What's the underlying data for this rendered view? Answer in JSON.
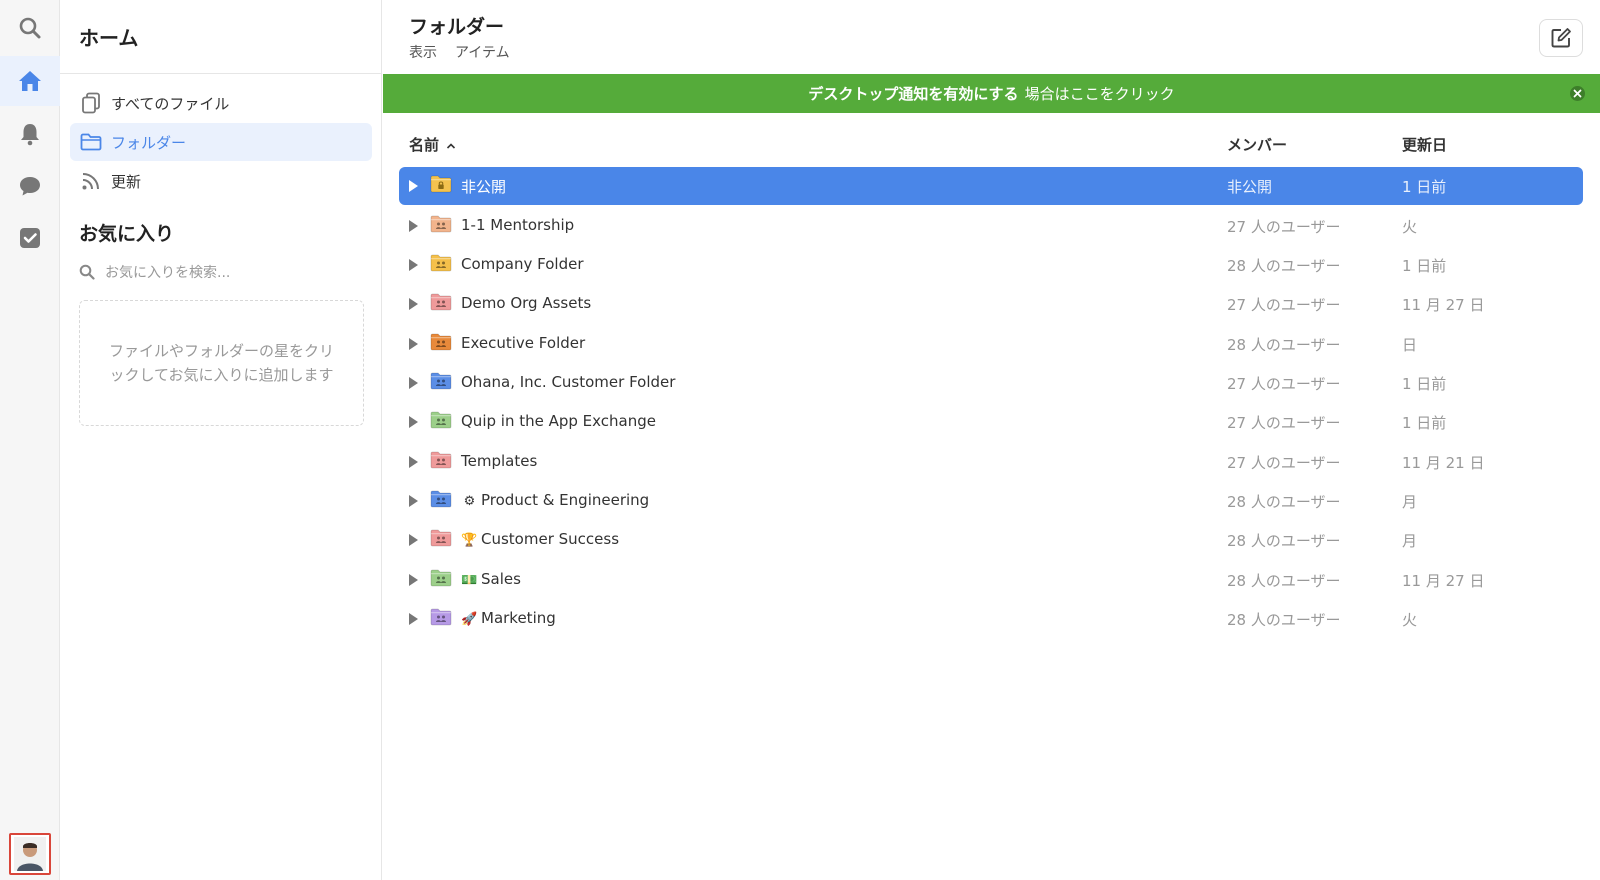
{
  "rail": {
    "icons": [
      "search-icon",
      "home-icon",
      "bell-icon",
      "chat-icon",
      "checkbox-icon"
    ],
    "active": "home-icon"
  },
  "sidebar": {
    "title": "ホーム",
    "items": [
      {
        "label": "すべてのファイル",
        "icon": "files-icon"
      },
      {
        "label": "フォルダー",
        "icon": "folder-outline-icon"
      },
      {
        "label": "更新",
        "icon": "rss-icon"
      }
    ],
    "favorites_title": "お気に入り",
    "favorites_search_placeholder": "お気に入りを検索...",
    "favorites_empty": "ファイルやフォルダーの星をクリックしてお気に入りに追加します"
  },
  "main": {
    "title": "フォルダー",
    "subtabs": [
      "表示",
      "アイテム"
    ],
    "banner": {
      "bold": "デスクトップ通知を有効にする",
      "rest": "場合はここをクリック"
    },
    "columns": {
      "name": "名前",
      "members": "メンバー",
      "updated": "更新日"
    },
    "rows": [
      {
        "name": "非公開",
        "emoji": "",
        "members": "非公開",
        "updated": "1 日前",
        "color": "#f3c24f",
        "kind": "lock",
        "selected": true
      },
      {
        "name": "1-1 Mentorship",
        "emoji": "",
        "members": "27 人のユーザー",
        "updated": "火",
        "color": "#f2b48c",
        "kind": "people",
        "selected": false
      },
      {
        "name": "Company Folder",
        "emoji": "",
        "members": "28 人のユーザー",
        "updated": "1 日前",
        "color": "#f5c04a",
        "kind": "people",
        "selected": false
      },
      {
        "name": "Demo Org Assets",
        "emoji": "",
        "members": "27 人のユーザー",
        "updated": "11 月 27 日",
        "color": "#ef9a9a",
        "kind": "people",
        "selected": false
      },
      {
        "name": "Executive Folder",
        "emoji": "",
        "members": "28 人のユーザー",
        "updated": "日",
        "color": "#e8893a",
        "kind": "people",
        "selected": false
      },
      {
        "name": "Ohana, Inc. Customer Folder",
        "emoji": "",
        "members": "27 人のユーザー",
        "updated": "1 日前",
        "color": "#5b8ee6",
        "kind": "people",
        "selected": false
      },
      {
        "name": "Quip in the App Exchange",
        "emoji": "",
        "members": "27 人のユーザー",
        "updated": "1 日前",
        "color": "#9ccf8a",
        "kind": "people",
        "selected": false
      },
      {
        "name": "Templates",
        "emoji": "",
        "members": "27 人のユーザー",
        "updated": "11 月 21 日",
        "color": "#ef9a9a",
        "kind": "people",
        "selected": false
      },
      {
        "name": "Product & Engineering",
        "emoji": "⚙",
        "members": "28 人のユーザー",
        "updated": "月",
        "color": "#5b8ee6",
        "kind": "people",
        "selected": false
      },
      {
        "name": "Customer Success",
        "emoji": "🏆",
        "members": "28 人のユーザー",
        "updated": "月",
        "color": "#ef9a9a",
        "kind": "people",
        "selected": false
      },
      {
        "name": "Sales",
        "emoji": "💵",
        "members": "28 人のユーザー",
        "updated": "11 月 27 日",
        "color": "#9ccf8a",
        "kind": "people",
        "selected": false
      },
      {
        "name": "Marketing",
        "emoji": "🚀",
        "members": "28 人のユーザー",
        "updated": "火",
        "color": "#b69ae6",
        "kind": "people",
        "selected": false
      }
    ]
  }
}
